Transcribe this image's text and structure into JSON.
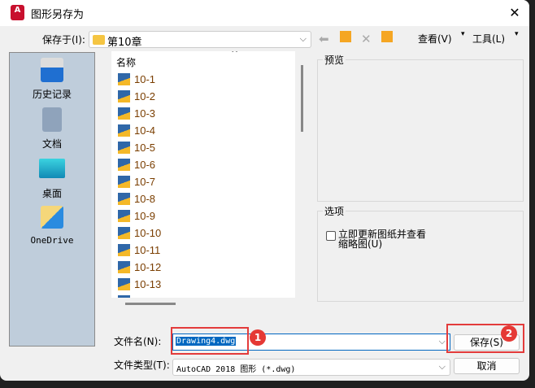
{
  "title": "图形另存为",
  "app_icon_letter": "A",
  "save_in": {
    "label": "保存于(I):",
    "value": "第10章"
  },
  "toolbar": {
    "view": "查看(V)",
    "tools": "工具(L)"
  },
  "sidebar": [
    {
      "label": "历史记录",
      "icon": "history-icon"
    },
    {
      "label": "文档",
      "icon": "documents-icon"
    },
    {
      "label": "桌面",
      "icon": "desktop-icon"
    },
    {
      "label": "OneDrive",
      "icon": "onedrive-icon"
    }
  ],
  "filelist": {
    "header": "名称",
    "items": [
      "10-1",
      "10-2",
      "10-3",
      "10-4",
      "10-5",
      "10-6",
      "10-7",
      "10-8",
      "10-9",
      "10-10",
      "10-11",
      "10-12",
      "10-13"
    ]
  },
  "preview": {
    "label": "预览"
  },
  "options": {
    "label": "选项",
    "checkbox_line1": "立即更新图纸并查看",
    "checkbox_line2": "缩略图(U)",
    "checked": false
  },
  "filename": {
    "label": "文件名(N):",
    "value": "Drawing4.dwg"
  },
  "filetype": {
    "label": "文件类型(T):",
    "value": "AutoCAD 2018 图形 (*.dwg)"
  },
  "buttons": {
    "save": "保存(S)",
    "cancel": "取消"
  },
  "badges": [
    "1",
    "2"
  ],
  "colors": {
    "highlight": "#e33b3b",
    "selection": "#0067c0"
  }
}
